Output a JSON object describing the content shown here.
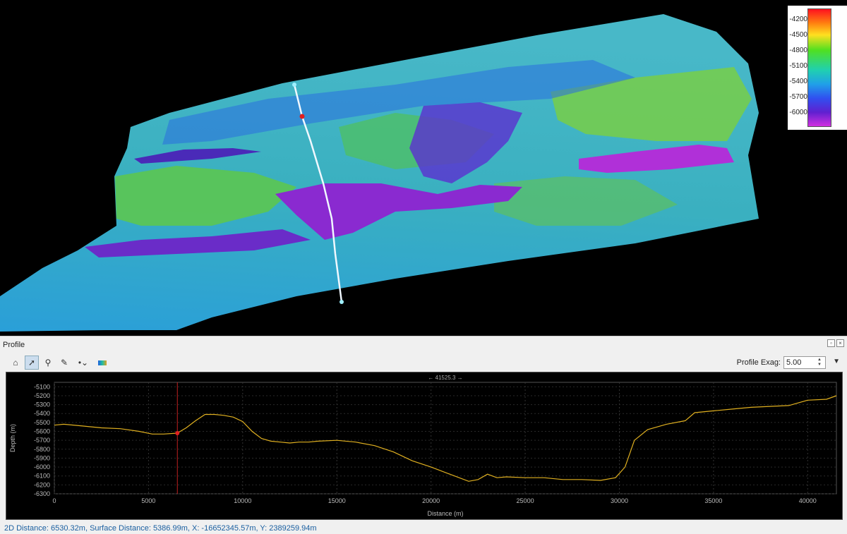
{
  "colorbar": {
    "labels": [
      "-4200",
      "-4500",
      "-4800",
      "-5100",
      "-5400",
      "-5700",
      "-6000"
    ]
  },
  "panel": {
    "title": "Profile",
    "exag_label": "Profile Exag:",
    "exag_value": "5.00"
  },
  "toolbar": {
    "icons": [
      "home-icon",
      "pointer-icon",
      "zoom-icon",
      "measure-icon",
      "marker-icon",
      "palette-icon"
    ]
  },
  "status": "2D Distance: 6530.32m, Surface Distance: 5386.99m, X: -16652345.57m, Y: 2389259.94m",
  "chart_data": {
    "type": "line",
    "title": "",
    "top_label": "← 41525.3 →",
    "xlabel": "Distance (m)",
    "ylabel": "Depth (m)",
    "xlim": [
      0,
      41525.3
    ],
    "ylim": [
      -6300,
      -5050
    ],
    "xticks": [
      0,
      5000,
      10000,
      15000,
      20000,
      25000,
      30000,
      35000,
      40000
    ],
    "yticks": [
      -5100,
      -5200,
      -5300,
      -5400,
      -5500,
      -5600,
      -5700,
      -5800,
      -5900,
      -6000,
      -6100,
      -6200,
      -6300
    ],
    "cursor_x": 6530.32,
    "cursor_y": -5620,
    "series": [
      {
        "color": "#e0b020",
        "x": [
          0,
          500,
          1500,
          2500,
          3500,
          4500,
          5200,
          5800,
          6530,
          7000,
          7500,
          8000,
          8500,
          9000,
          9500,
          10000,
          10500,
          11000,
          11500,
          12000,
          12500,
          13000,
          13500,
          14000,
          15000,
          16000,
          17000,
          18000,
          19000,
          20000,
          21000,
          22000,
          22500,
          23000,
          23500,
          24000,
          25000,
          26000,
          27000,
          28000,
          29000,
          29800,
          30300,
          30800,
          31500,
          32500,
          33500,
          34000,
          35000,
          36000,
          37000,
          38000,
          39000,
          40000,
          41000,
          41525
        ],
        "y": [
          -5530,
          -5520,
          -5540,
          -5560,
          -5570,
          -5600,
          -5630,
          -5630,
          -5620,
          -5560,
          -5480,
          -5410,
          -5410,
          -5420,
          -5440,
          -5490,
          -5600,
          -5680,
          -5710,
          -5720,
          -5730,
          -5720,
          -5720,
          -5710,
          -5700,
          -5720,
          -5760,
          -5830,
          -5930,
          -6000,
          -6080,
          -6160,
          -6140,
          -6080,
          -6120,
          -6110,
          -6120,
          -6120,
          -6140,
          -6140,
          -6150,
          -6120,
          -6000,
          -5700,
          -5580,
          -5520,
          -5480,
          -5390,
          -5370,
          -5350,
          -5330,
          -5320,
          -5310,
          -5250,
          -5240,
          -5200
        ]
      }
    ]
  }
}
